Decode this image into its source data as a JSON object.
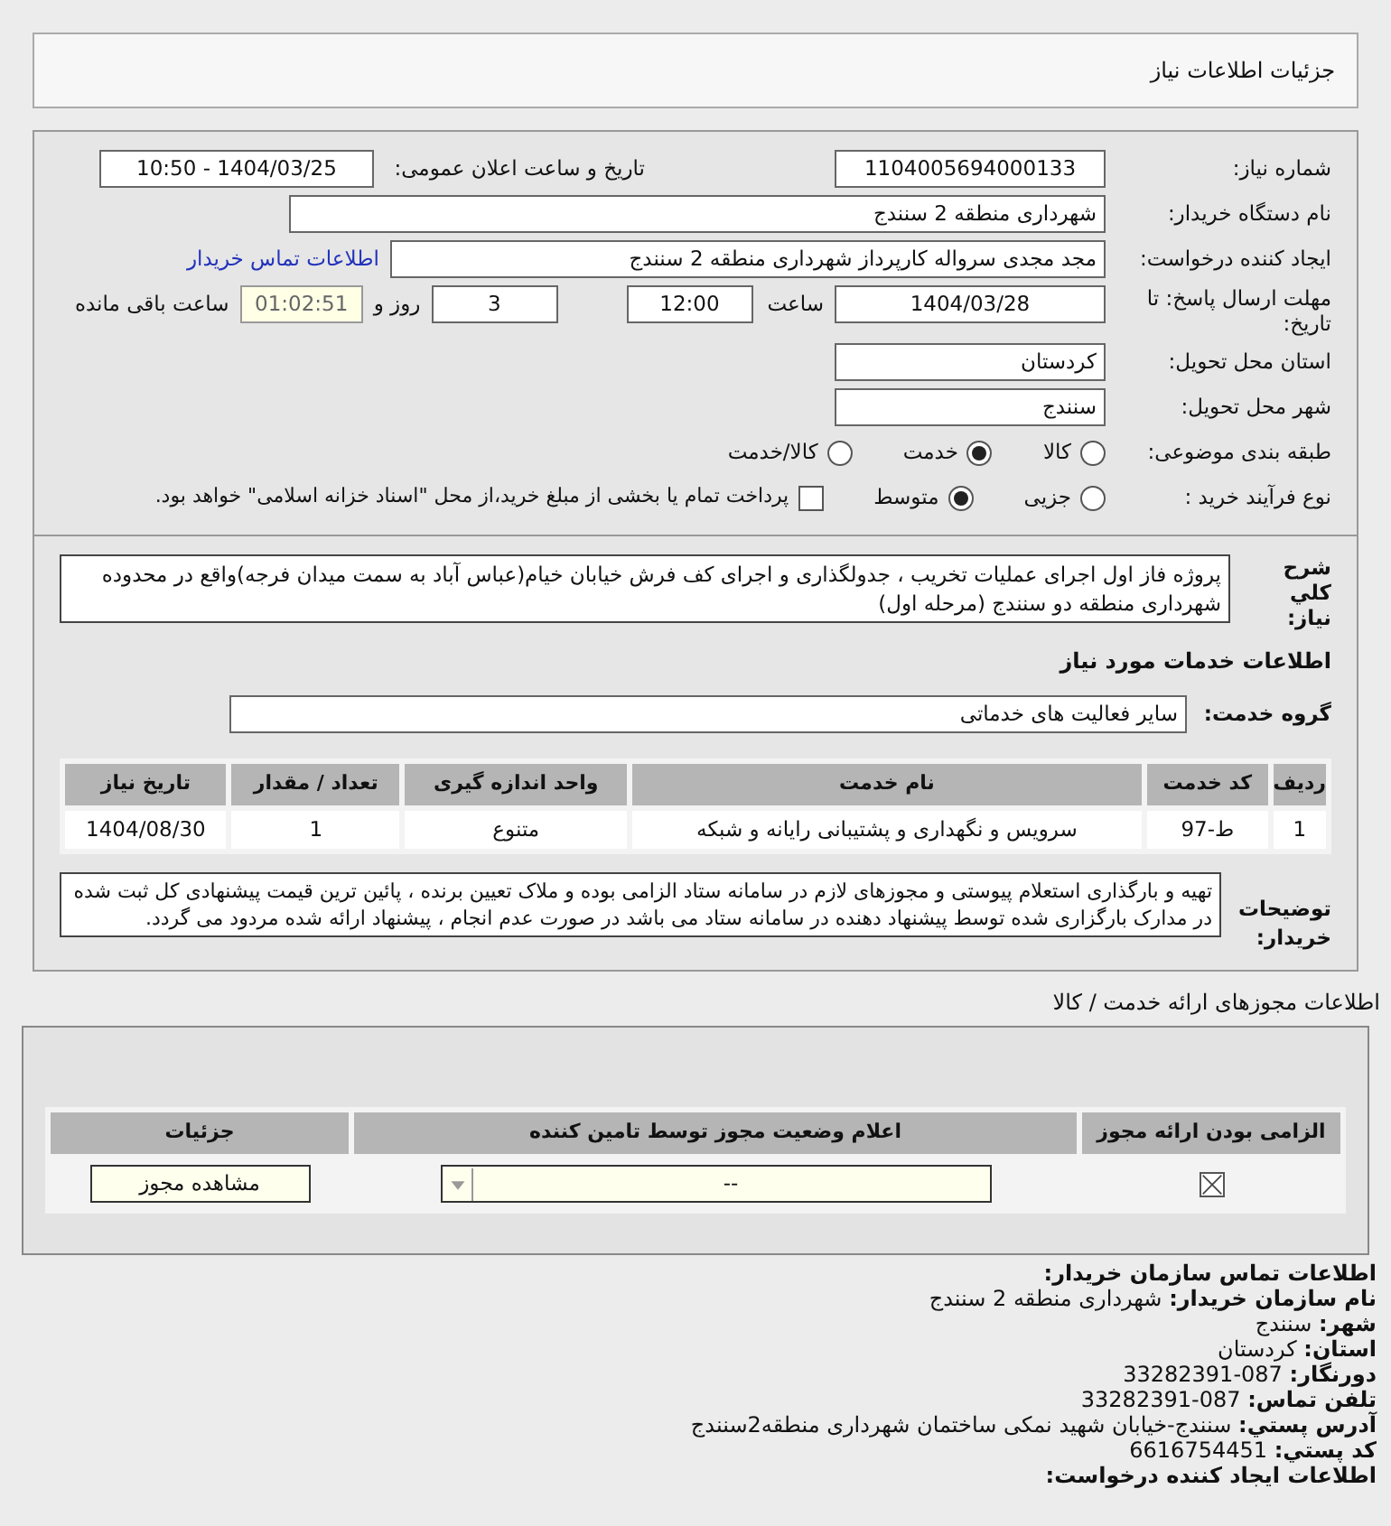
{
  "title": "جزئیات اطلاعات نیاز",
  "need_number": {
    "label": "شماره نیاز:",
    "value": "1104005694000133"
  },
  "announce": {
    "label": "تاریخ و ساعت اعلان عمومی:",
    "value": "1404/03/25 - 10:50"
  },
  "buyer_org": {
    "label": "نام دستگاه خریدار:",
    "value": "شهرداری منطقه 2 سنندج"
  },
  "requester": {
    "label": "ایجاد کننده درخواست:",
    "value": "مجد مجدی سرواله کارپرداز شهرداری منطقه 2 سنندج",
    "link": "اطلاعات تماس خریدار"
  },
  "deadline": {
    "label": "مهلت ارسال پاسخ: تا تاریخ:",
    "date": "1404/03/28",
    "time_label": "ساعت",
    "time": "12:00",
    "days": "3",
    "days_label": "روز و",
    "remaining": "01:02:51",
    "remaining_label": "ساعت باقی مانده"
  },
  "province": {
    "label": "استان محل تحویل:",
    "value": "کردستان"
  },
  "city": {
    "label": "شهر محل تحویل:",
    "value": "سنندج"
  },
  "category": {
    "label": "طبقه بندی موضوعی:",
    "options": [
      {
        "label": "کالا",
        "selected": false
      },
      {
        "label": "خدمت",
        "selected": true
      },
      {
        "label": "کالا/خدمت",
        "selected": false
      }
    ]
  },
  "process": {
    "label": "نوع فرآیند خرید :",
    "options": [
      {
        "label": "جزیی",
        "selected": false
      },
      {
        "label": "متوسط",
        "selected": true
      }
    ],
    "payment": {
      "checked": false,
      "label": "پرداخت تمام یا بخشی از مبلغ خرید،از محل \"اسناد خزانه اسلامی\" خواهد بود."
    }
  },
  "description": {
    "label": "شرح کلي نیاز:",
    "value": "پروژه فاز اول اجرای عملیات تخریب ، جدولگذاری و اجرای کف فرش خیابان خیام(عباس آباد به سمت میدان فرجه)واقع در محدوده شهرداری منطقه دو سنندج (مرحله اول)"
  },
  "services_heading": "اطلاعات خدمات مورد نیاز",
  "service_group": {
    "label": "گروه خدمت:",
    "value": "سایر فعالیت های خدماتی"
  },
  "services_table": {
    "columns": [
      "ردیف",
      "کد خدمت",
      "نام خدمت",
      "واحد اندازه گیری",
      "تعداد / مقدار",
      "تاریخ نیاز"
    ],
    "rows": [
      [
        "1",
        "ط-97",
        "سرویس و نگهداری و پشتیبانی رایانه و شبکه",
        "متنوع",
        "1",
        "1404/08/30"
      ]
    ]
  },
  "buyer_notes": {
    "label": "توضیحات خریدار:",
    "value": "تهیه و بارگذاری استعلام پیوستی و مجوزهای لازم در سامانه ستاد الزامی بوده و ملاک تعیین برنده ، پائین ترین قیمت پیشنهادی کل ثبت شده در مدارک بارگزاری شده توسط پیشنهاد دهنده در سامانه ستاد می باشد در صورت عدم انجام ، پیشنهاد ارائه شده مردود می گردد."
  },
  "licenses_heading": "اطلاعات مجوزهای ارائه خدمت / کالا",
  "licenses_table": {
    "columns": [
      "الزامی بودن ارائه مجوز",
      "اعلام وضعیت مجوز توسط تامین کننده",
      "جزئیات"
    ],
    "rows": [
      {
        "required": true,
        "status": "--",
        "button": "مشاهده مجوز"
      }
    ]
  },
  "contact": [
    "**اطلاعات تماس سازمان خریدار:**",
    "**نام سازمان خریدار:** شهرداری منطقه 2 سنندج",
    "**شهر:** سنندج",
    "**استان:** کردستان",
    "**دورنگار:** 087-33282391",
    "**تلفن تماس:** 087-33282391",
    "**آدرس پستي:** سنندج-خیابان شهید نمکی ساختمان شهرداری منطقه2سنندج",
    "**کد پستي:** 6616754451",
    "**اطلاعات ایجاد کننده درخواست:**"
  ]
}
